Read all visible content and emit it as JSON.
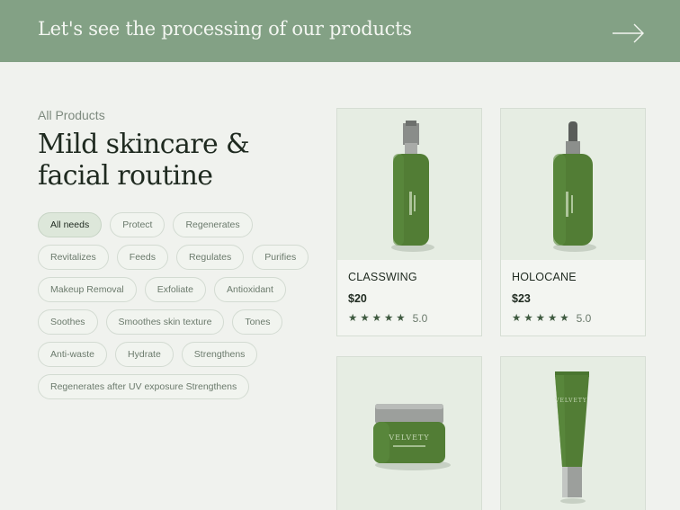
{
  "banner": {
    "title": "Let's see the processing of our products"
  },
  "section": {
    "crumb": "All Products",
    "headline": "Mild skincare & facial routine"
  },
  "filters": {
    "rows": [
      [
        "All needs",
        "Protect",
        "Regenerates"
      ],
      [
        "Revitalizes",
        "Feeds",
        "Regulates",
        "Purifies"
      ],
      [
        "Makeup Removal",
        "Exfoliate",
        "Antioxidant"
      ],
      [
        "Soothes",
        "Smoothes skin texture",
        "Tones"
      ],
      [
        "Anti-waste",
        "Hydrate",
        "Strengthens"
      ],
      [
        "Regenerates after UV exposure Strengthens"
      ]
    ],
    "active": "All needs"
  },
  "products": [
    {
      "name": "CLASSWING",
      "price": "$20",
      "rating": "5.0",
      "stars": 5,
      "image": "spray-bottle"
    },
    {
      "name": "HOLOCANE",
      "price": "$23",
      "rating": "5.0",
      "stars": 5,
      "image": "dropper-bottle"
    },
    {
      "image": "cream-jar",
      "brand": "VELVETY"
    },
    {
      "image": "tube",
      "brand": "VELVETY"
    }
  ],
  "colors": {
    "banner": "#83a185",
    "page": "#f0f2ee",
    "product_green": "#4f7a34",
    "star": "#3f5a40"
  }
}
